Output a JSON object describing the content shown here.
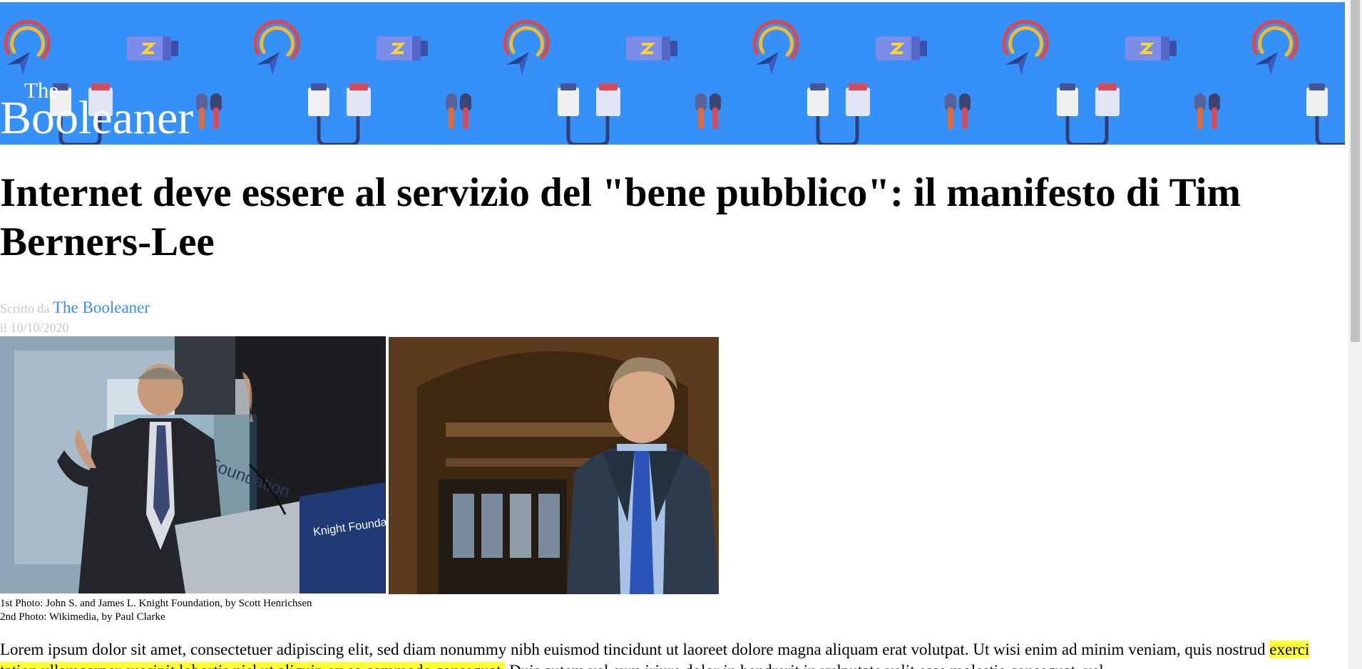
{
  "site": {
    "brand_small": "The",
    "brand_big": "Booleaner",
    "header_color": "#3591f7",
    "header_icons": [
      "compass-gauge-icon",
      "battery-icon",
      "earphones-icon",
      "earbuds-icon"
    ]
  },
  "article": {
    "title": "Internet deve essere al servizio del \"bene pubblico\": il manifesto di Tim Berners-Lee",
    "byline_prefix": "Scritto da",
    "author": "The Booleaner",
    "date": "il 10/10/2020",
    "captions": [
      "1st Photo: John S. and James L. Knight Foundation, by Scott Henrichsen",
      "2nd Photo: Wikimedia, by Paul Clarke"
    ],
    "body": {
      "part1": "Lorem ipsum dolor sit amet, consectetuer adipiscing elit, sed diam nonummy nibh euismod tincidunt ut laoreet dolore magna aliquam erat volutpat. Ut wisi enim ad minim veniam, quis nostrud ",
      "highlight": "exerci tation ullamcorper suscipit lobortis nisl ut aliquip ex ea commodo consequat.",
      "part2": " Duis autem vel eum iriure dolor in hendrerit in vulputate velit esse molestie consequat, vel"
    },
    "link_color": "#3591f7",
    "highlight_color": "#ffff33"
  }
}
